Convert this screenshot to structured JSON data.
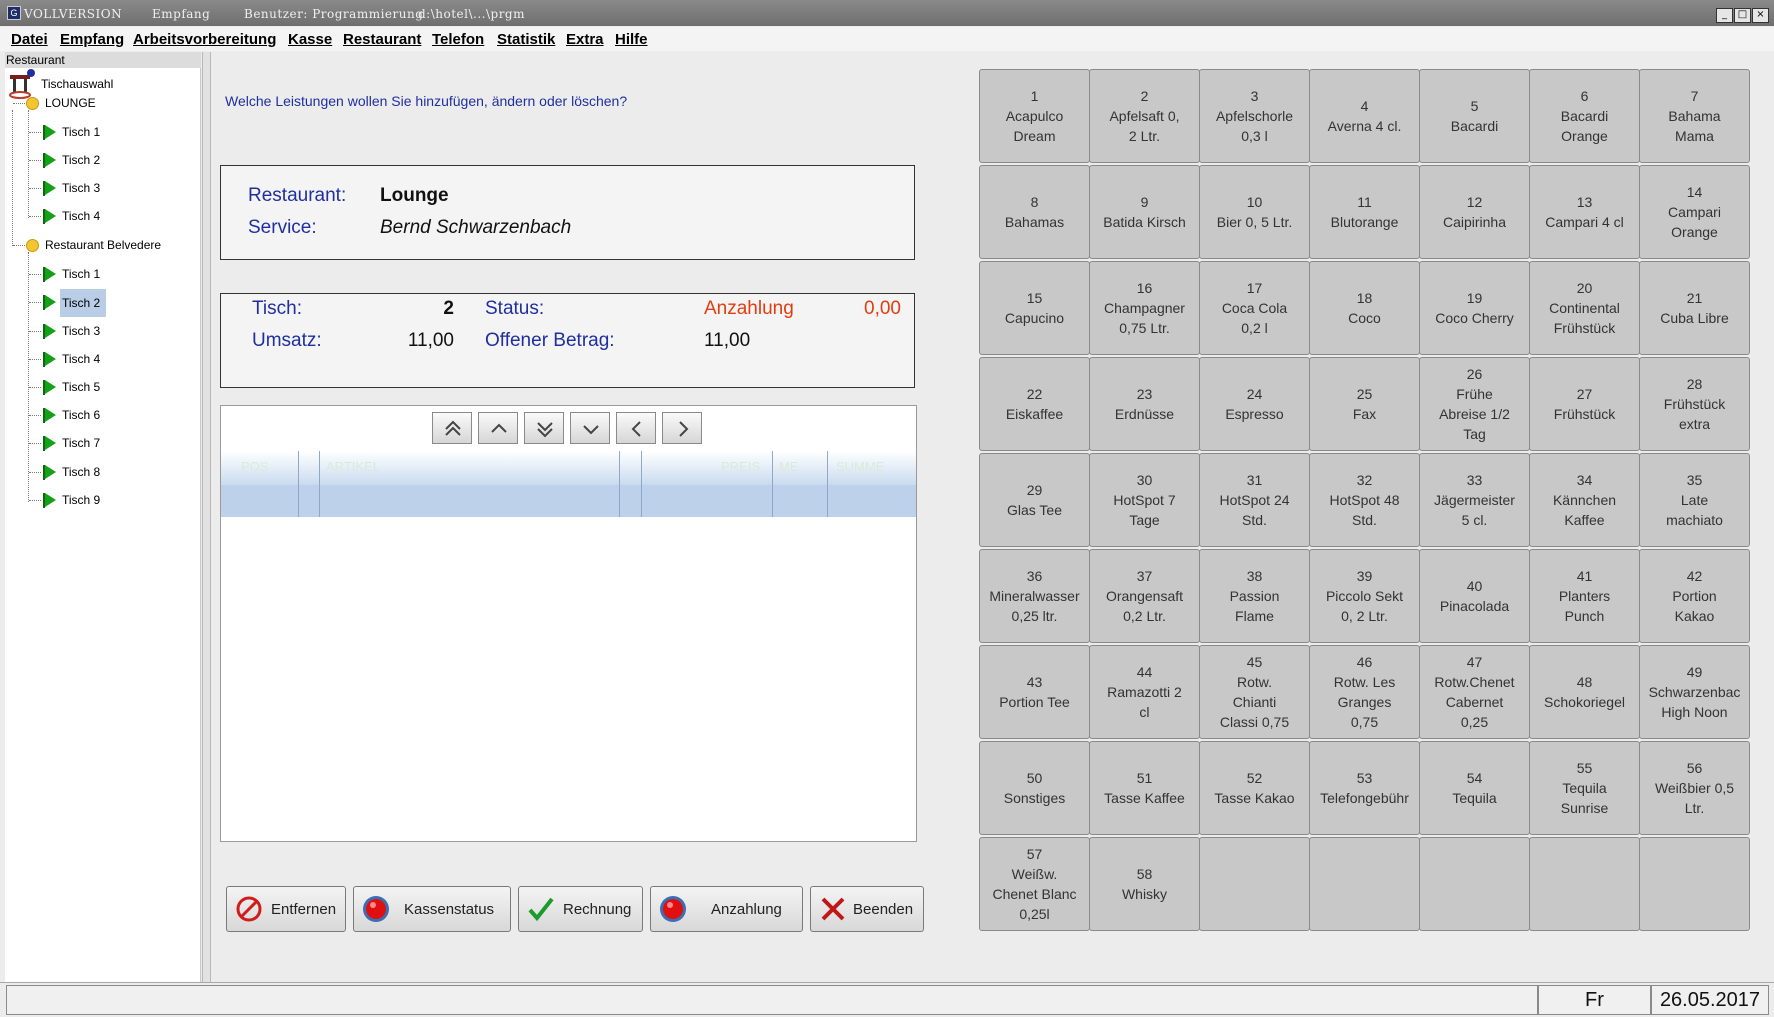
{
  "titlebar": {
    "app_icon": "G",
    "edition": "VOLLVERSION",
    "module": "Empfang",
    "user": "Benutzer: Programmierung",
    "path": "d:\\hotel\\...\\prgm",
    "controls": [
      "_",
      "□",
      "×"
    ]
  },
  "menu": [
    "Datei",
    "Empfang",
    "Arbeitsvorbereitung",
    "Kasse",
    "Restaurant",
    "Telefon",
    "Statistik",
    "Extra",
    "Hilfe"
  ],
  "sidebar": {
    "header": "Restaurant",
    "root": "Tischauswahl",
    "groups": [
      {
        "label": "LOUNGE",
        "tables": [
          "Tisch 1",
          "Tisch 2",
          "Tisch 3",
          "Tisch 4"
        ]
      },
      {
        "label": "Restaurant Belvedere",
        "tables": [
          "Tisch 1",
          "Tisch 2",
          "Tisch 3",
          "Tisch 4",
          "Tisch 5",
          "Tisch 6",
          "Tisch 7",
          "Tisch 8",
          "Tisch 9"
        ]
      }
    ],
    "selected": "Restaurant Belvedere / Tisch 2"
  },
  "main": {
    "question": "Welche Leistungen wollen Sie hinzufügen, ändern oder löschen?",
    "info": {
      "restaurant_label": "Restaurant:",
      "restaurant_value": "Lounge",
      "service_label": "Service:",
      "service_value": "Bernd Schwarzenbach"
    },
    "table_info": {
      "tisch_label": "Tisch:",
      "tisch_value": "2",
      "status_label": "Status:",
      "status_value": "Anzahlung",
      "anzahlung_value": "0,00",
      "umsatz_label": "Umsatz:",
      "umsatz_value": "11,00",
      "offen_label": "Offener Betrag:",
      "offen_value": "11,00"
    },
    "grid": {
      "nav_buttons": [
        "first-icon",
        "up-icon",
        "last-icon",
        "down-icon",
        "left-icon",
        "right-icon"
      ],
      "columns": [
        "POS",
        "ARTIKEL",
        "PREIS",
        "ME",
        "SUMME"
      ]
    }
  },
  "actions": {
    "entfernen": "Entfernen",
    "kassenstatus": "Kassenstatus",
    "rechnung": "Rechnung",
    "anzahlung": "Anzahlung",
    "beenden": "Beenden"
  },
  "products": [
    {
      "num": "1",
      "name": "Acapulco\nDream"
    },
    {
      "num": "2",
      "name": "Apfelsaft 0,\n2 Ltr."
    },
    {
      "num": "3",
      "name": "Apfelschorle\n0,3 l"
    },
    {
      "num": "4",
      "name": "Averna 4 cl."
    },
    {
      "num": "5",
      "name": "Bacardi"
    },
    {
      "num": "6",
      "name": "Bacardi\nOrange"
    },
    {
      "num": "7",
      "name": "Bahama\nMama"
    },
    {
      "num": "8",
      "name": "Bahamas"
    },
    {
      "num": "9",
      "name": "Batida Kirsch"
    },
    {
      "num": "10",
      "name": "Bier 0, 5 Ltr."
    },
    {
      "num": "11",
      "name": "Blutorange"
    },
    {
      "num": "12",
      "name": "Caipirinha"
    },
    {
      "num": "13",
      "name": "Campari 4 cl"
    },
    {
      "num": "14",
      "name": "Campari\nOrange"
    },
    {
      "num": "15",
      "name": "Capucino"
    },
    {
      "num": "16",
      "name": "Champagner\n0,75 Ltr."
    },
    {
      "num": "17",
      "name": "Coca Cola\n0,2 l"
    },
    {
      "num": "18",
      "name": "Coco"
    },
    {
      "num": "19",
      "name": "Coco Cherry"
    },
    {
      "num": "20",
      "name": "Continental\nFrühstück"
    },
    {
      "num": "21",
      "name": "Cuba Libre"
    },
    {
      "num": "22",
      "name": "Eiskaffee"
    },
    {
      "num": "23",
      "name": "Erdnüsse"
    },
    {
      "num": "24",
      "name": "Espresso"
    },
    {
      "num": "25",
      "name": "Fax"
    },
    {
      "num": "26",
      "name": "Frühe\nAbreise 1/2\nTag"
    },
    {
      "num": "27",
      "name": "Frühstück"
    },
    {
      "num": "28",
      "name": "Frühstück\nextra"
    },
    {
      "num": "29",
      "name": "Glas Tee"
    },
    {
      "num": "30",
      "name": "HotSpot 7\nTage"
    },
    {
      "num": "31",
      "name": "HotSpot 24\nStd."
    },
    {
      "num": "32",
      "name": "HotSpot 48\nStd."
    },
    {
      "num": "33",
      "name": "Jägermeister\n5 cl."
    },
    {
      "num": "34",
      "name": "Kännchen\nKaffee"
    },
    {
      "num": "35",
      "name": "Late\nmachiato"
    },
    {
      "num": "36",
      "name": "Mineralwasser\n0,25 ltr."
    },
    {
      "num": "37",
      "name": "Orangensaft\n0,2 Ltr."
    },
    {
      "num": "38",
      "name": "Passion\nFlame"
    },
    {
      "num": "39",
      "name": "Piccolo Sekt\n0, 2 Ltr."
    },
    {
      "num": "40",
      "name": "Pinacolada"
    },
    {
      "num": "41",
      "name": "Planters\nPunch"
    },
    {
      "num": "42",
      "name": "Portion\nKakao"
    },
    {
      "num": "43",
      "name": "Portion Tee"
    },
    {
      "num": "44",
      "name": "Ramazotti 2\ncl"
    },
    {
      "num": "45",
      "name": "Rotw.\nChianti\nClassi 0,75"
    },
    {
      "num": "46",
      "name": "Rotw. Les\nGranges\n0,75"
    },
    {
      "num": "47",
      "name": "Rotw.Chenet\nCabernet\n0,25"
    },
    {
      "num": "48",
      "name": "Schokoriegel"
    },
    {
      "num": "49",
      "name": "Schwarzenbac\nHigh Noon"
    },
    {
      "num": "50",
      "name": "Sonstiges"
    },
    {
      "num": "51",
      "name": "Tasse Kaffee"
    },
    {
      "num": "52",
      "name": "Tasse Kakao"
    },
    {
      "num": "53",
      "name": "Telefongebühr"
    },
    {
      "num": "54",
      "name": "Tequila"
    },
    {
      "num": "55",
      "name": "Tequila\nSunrise"
    },
    {
      "num": "56",
      "name": "Weißbier 0,5\nLtr."
    },
    {
      "num": "57",
      "name": "Weißw.\nChenet Blanc\n0,25l"
    },
    {
      "num": "58",
      "name": "Whisky"
    },
    {
      "num": "",
      "name": ""
    },
    {
      "num": "",
      "name": ""
    },
    {
      "num": "",
      "name": ""
    },
    {
      "num": "",
      "name": ""
    },
    {
      "num": "",
      "name": ""
    }
  ],
  "statusbar": {
    "day": "Fr",
    "date": "26.05.2017"
  },
  "colors": {
    "label_blue": "#1f2fa0",
    "status_red": "#e23d10",
    "tree_flag": "#16a01a",
    "tile_bg": "#c8c8c8"
  }
}
